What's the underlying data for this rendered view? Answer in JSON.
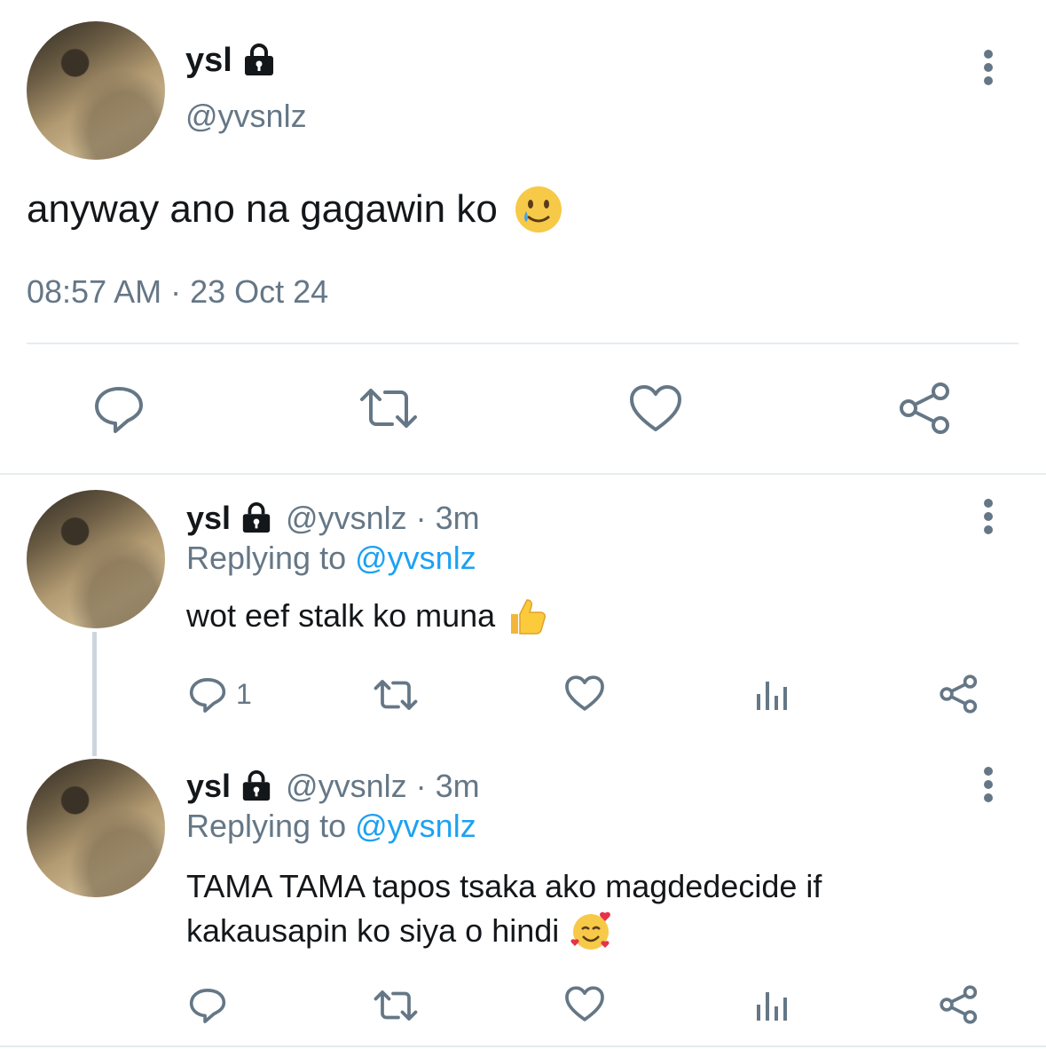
{
  "main_tweet": {
    "display_name": "ysl",
    "handle": "@yvsnlz",
    "text": "anyway ano na gagawin ko",
    "timestamp": "08:57 AM · 23 Oct 24"
  },
  "replies": [
    {
      "display_name": "ysl",
      "handle_time": "@yvsnlz · 3m",
      "replying_prefix": "Replying to",
      "replying_to": "@yvsnlz",
      "text": "wot eef stalk ko muna",
      "reply_count": "1"
    },
    {
      "display_name": "ysl",
      "handle_time": "@yvsnlz · 3m",
      "replying_prefix": "Replying to",
      "replying_to": "@yvsnlz",
      "text_line1": "TAMA TAMA tapos tsaka ako magdedecide if",
      "text_line2": "kakausapin ko siya o hindi",
      "reply_count": ""
    }
  ],
  "icons": {
    "lock": "lock-icon",
    "more": "more-vertical-icon",
    "reply": "reply-icon",
    "retweet": "retweet-icon",
    "like": "heart-icon",
    "analytics": "analytics-icon",
    "share": "share-icon"
  },
  "colors": {
    "text": "#14171a",
    "secondary": "#657786",
    "link": "#1da1f2",
    "divider": "#e6ecf0"
  }
}
